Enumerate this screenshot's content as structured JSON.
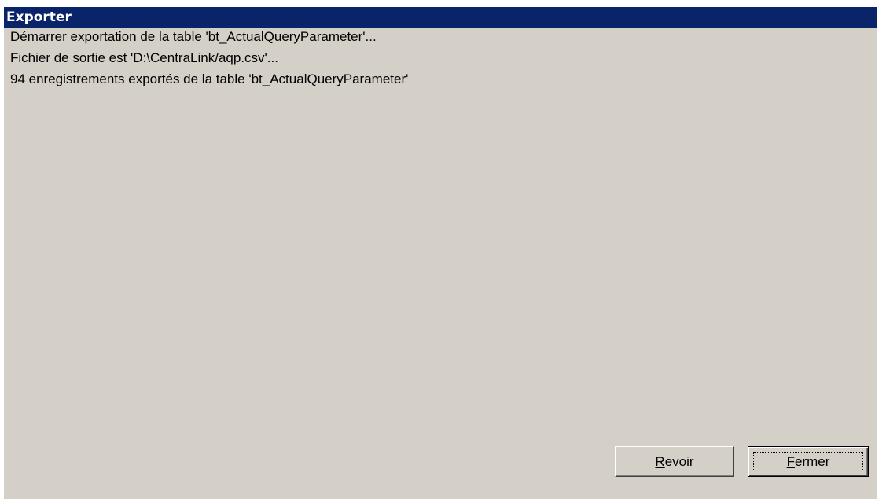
{
  "window": {
    "title": "Exporter"
  },
  "log": {
    "lines": [
      "Démarrer exportation de la table 'bt_ActualQueryParameter'...",
      "Fichier de sortie est 'D:\\CentraLink/aqp.csv'...",
      "94 enregistrements exportés de la table 'bt_ActualQueryParameter'"
    ]
  },
  "buttons": {
    "revoir": {
      "mnemonic": "R",
      "rest": "evoir"
    },
    "fermer": {
      "mnemonic": "F",
      "rest": "ermer"
    }
  },
  "colors": {
    "titlebar": "#0a246a",
    "dialog_background": "#d4d0c8",
    "title_text": "#ffffff"
  }
}
